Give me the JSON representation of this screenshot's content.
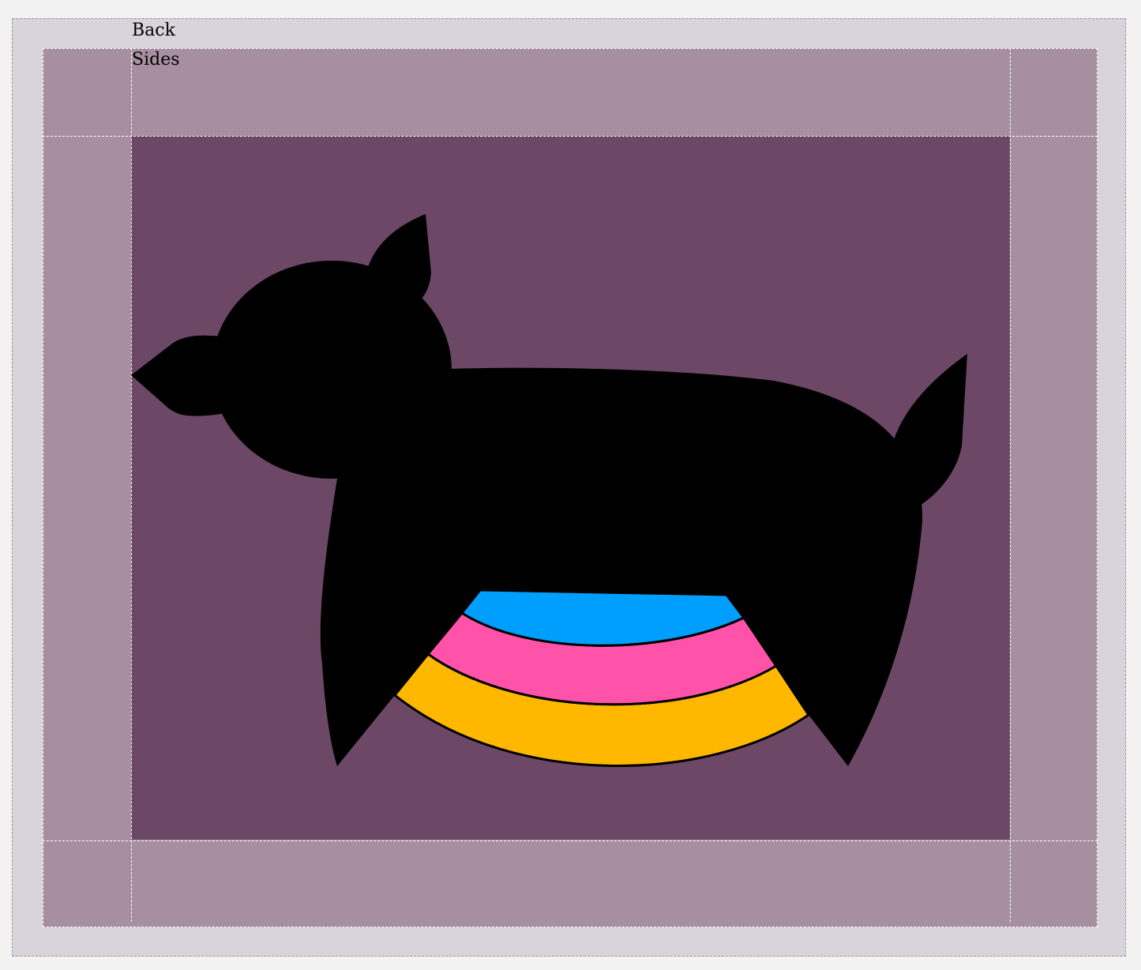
{
  "labels": {
    "back": "Back",
    "sides": "Sides"
  },
  "colors": {
    "page_background": "#f2f2f2",
    "outer_panel": "#d9d3db",
    "sides_panel": "#a78fa1",
    "back_panel": "#6c4866",
    "silhouette": "#000000",
    "band_blue": "#009ffd",
    "band_pink": "#ff52a8",
    "band_yellow": "#ffb700"
  },
  "figure": {
    "subject": "pig-silhouette",
    "bands": [
      "blue",
      "pink",
      "yellow"
    ]
  }
}
